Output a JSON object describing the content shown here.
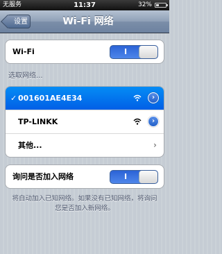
{
  "status_bar": {
    "carrier": "无服务",
    "time": "11:37",
    "battery_text": "32%",
    "battery_level": 0.32
  },
  "nav": {
    "back_label": "设置",
    "title": "Wi-Fi 网络"
  },
  "wifi_toggle": {
    "label": "Wi-Fi",
    "state": "on",
    "on_symbol": "I"
  },
  "network_section": {
    "header": "选取网络...",
    "networks": [
      {
        "name": "001601AE4E34",
        "selected": true,
        "check": "✓",
        "signal_icon": "wifi-signal-icon",
        "detail": "›"
      },
      {
        "name": "TP-LINKK",
        "selected": false,
        "signal_icon": "wifi-signal-icon",
        "detail": "›"
      }
    ],
    "other": {
      "label": "其他...",
      "chevron": "›"
    }
  },
  "ask_toggle": {
    "label": "询问是否加入网络",
    "state": "on",
    "on_symbol": "I"
  },
  "footer": "将自动加入已知网络。如果没有已知网络，将询问您是否加入新网络。",
  "colors": {
    "selected_row": "#0a6ef0",
    "toggle_on": "#2b63d6",
    "nav_bar": "#8e9fb6",
    "background": "#c5ccd4"
  }
}
